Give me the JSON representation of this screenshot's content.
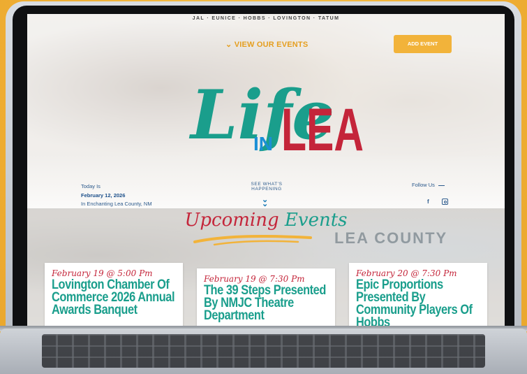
{
  "site": {
    "towns": "JAL · EUNICE · HOBBS · LOVINGTON · TATUM",
    "view_events": "VIEW OUR EVENTS",
    "add_event": "ADD EVENT"
  },
  "logo": {
    "script": "Life",
    "in": "IN",
    "lea": "LEA",
    "colors": {
      "script": "#1a9e8c",
      "in": "#1a8fd6",
      "lea": "#c4253a"
    }
  },
  "info": {
    "today_label": "Today Is",
    "today_date": "February 12, 2026",
    "location": "In Enchanting Lea County, NM",
    "see_line1": "SEE WHAT'S",
    "see_line2": "HAPPENING",
    "follow": "Follow Us",
    "social": [
      "facebook-icon",
      "instagram-icon"
    ]
  },
  "events": {
    "title_1": "Upcoming",
    "title_2": "Events",
    "background_sign": "LEA COUNTY",
    "cards": [
      {
        "date": "February 19 @ 5:00 Pm",
        "title": "Lovington Chamber Of Commerce 2026 Annual Awards Banquet"
      },
      {
        "date": "February 19 @ 7:30 Pm",
        "title": "The 39 Steps Presented By NMJC Theatre Department"
      },
      {
        "date": "February 20 @ 7:30 Pm",
        "title": "Epic Proportions Presented By Community Players Of Hobbs"
      }
    ]
  },
  "colors": {
    "accent": "#f2b33a",
    "teal": "#1a9e8c",
    "red": "#c4253a",
    "blue": "#2c5a8c"
  }
}
